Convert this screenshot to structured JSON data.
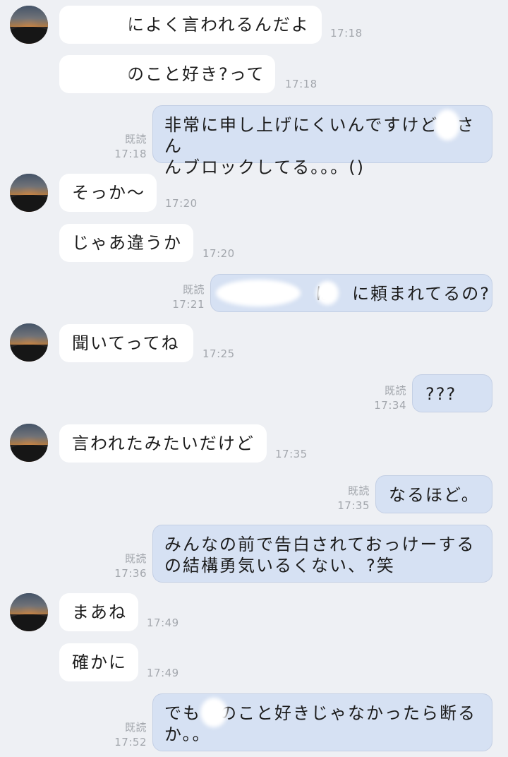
{
  "messages": [
    {
      "side": "in",
      "avatar": true,
      "text": "　　　によく言われるんだよ",
      "time": "17:18"
    },
    {
      "side": "in",
      "avatar": false,
      "text": "　　　のこと好き?って",
      "time": "17:18"
    },
    {
      "side": "out",
      "read": "既読",
      "time": "17:18",
      "text": "非常に申し上げにくいんですけど　さん\nんブロックしてる。。。()"
    },
    {
      "side": "in",
      "avatar": true,
      "text": "そっか〜",
      "time": "17:20"
    },
    {
      "side": "in",
      "avatar": false,
      "text": "じゃあ違うか",
      "time": "17:20"
    },
    {
      "side": "out",
      "read": "既読",
      "time": "17:21",
      "text": "　　　　　は　に頼まれてるの?"
    },
    {
      "side": "in",
      "avatar": true,
      "text": "聞いてってね",
      "time": "17:25"
    },
    {
      "side": "out",
      "read": "既読",
      "time": "17:34",
      "text": "???"
    },
    {
      "side": "in",
      "avatar": true,
      "text": "言われたみたいだけど",
      "time": "17:35"
    },
    {
      "side": "out",
      "read": "既読",
      "time": "17:35",
      "text": "なるほど。"
    },
    {
      "side": "out",
      "read": "既読",
      "time": "17:36",
      "text": "みんなの前で告白されておっけーする\nの結構勇気いるくない、?笑"
    },
    {
      "side": "in",
      "avatar": true,
      "text": "まあね",
      "time": "17:49"
    },
    {
      "side": "in",
      "avatar": false,
      "text": "確かに",
      "time": "17:49"
    },
    {
      "side": "out",
      "read": "既読",
      "time": "17:52",
      "text": "でも　のこと好きじゃなかったら断る\nか。。"
    }
  ]
}
